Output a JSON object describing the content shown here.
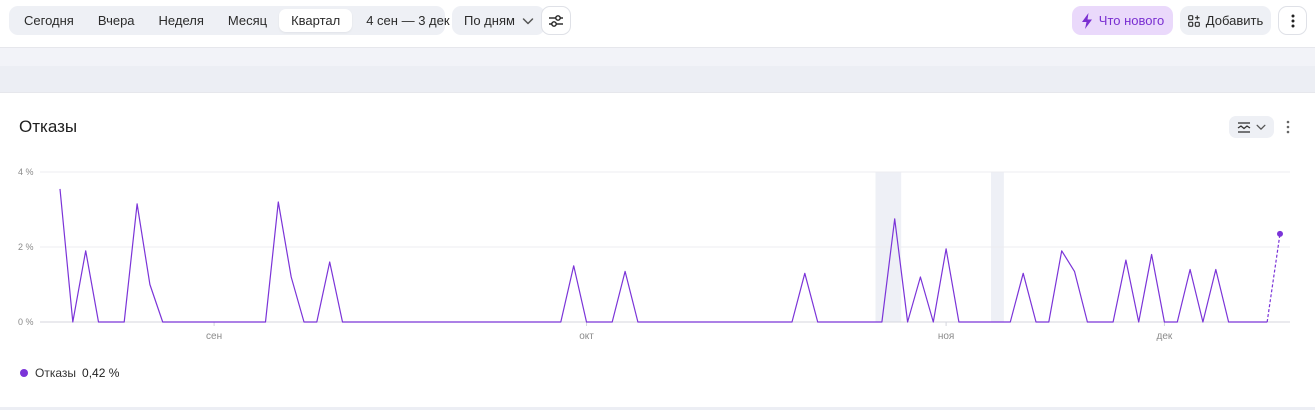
{
  "toolbar": {
    "periods": [
      "Сегодня",
      "Вчера",
      "Неделя",
      "Месяц",
      "Квартал"
    ],
    "active_period": "Квартал",
    "date_range": "4 сен — 3 дек",
    "grouping": "По дням",
    "whats_new": "Что нового",
    "add": "Добавить"
  },
  "icons": {
    "date_chevron": "chevron-down-icon",
    "grouping_chevron": "chevron-down-icon",
    "filter": "sliders-icon",
    "whats_new": "lightning-icon",
    "add": "widgets-icon",
    "more": "vertical-dots-icon"
  },
  "colors": {
    "accent": "#7b34d8",
    "accent_bg": "#ead9fb"
  },
  "widget": {
    "title": "Отказы",
    "legend_name": "Отказы",
    "legend_value": "0,42 %"
  },
  "chart_data": {
    "type": "line",
    "title": "",
    "xlabel": "",
    "ylabel": "",
    "y_ticks": [
      "4 %",
      "2 %",
      "0 %"
    ],
    "ylim": [
      0,
      4
    ],
    "x_tick_labels": [
      "сен",
      "окт",
      "ноя",
      "дек"
    ],
    "x_tick_index": [
      12,
      41,
      69,
      86
    ],
    "highlight_ranges": [
      [
        64,
        65
      ],
      [
        73,
        73
      ]
    ],
    "dashed_last_segment": true,
    "grid": true,
    "series": [
      {
        "name": "Отказы",
        "color": "#7b34d8",
        "values": [
          3.55,
          0,
          1.9,
          0,
          0,
          0,
          3.15,
          1.0,
          0,
          0,
          0,
          0,
          0,
          0,
          0,
          0,
          0,
          3.2,
          1.2,
          0,
          0,
          1.6,
          0,
          0,
          0,
          0,
          0,
          0,
          0,
          0,
          0,
          0,
          0,
          0,
          0,
          0,
          0,
          0,
          0,
          0,
          1.5,
          0,
          0,
          0,
          1.35,
          0,
          0,
          0,
          0,
          0,
          0,
          0,
          0,
          0,
          0,
          0,
          0,
          0,
          1.3,
          0,
          0,
          0,
          0,
          0,
          0,
          2.75,
          0,
          1.2,
          0,
          1.95,
          0,
          0,
          0,
          0,
          0,
          1.3,
          0,
          0,
          1.9,
          1.35,
          0,
          0,
          0,
          1.65,
          0,
          1.8,
          0,
          0,
          1.4,
          0,
          1.4,
          0,
          0,
          0,
          0,
          2.35
        ]
      }
    ]
  }
}
